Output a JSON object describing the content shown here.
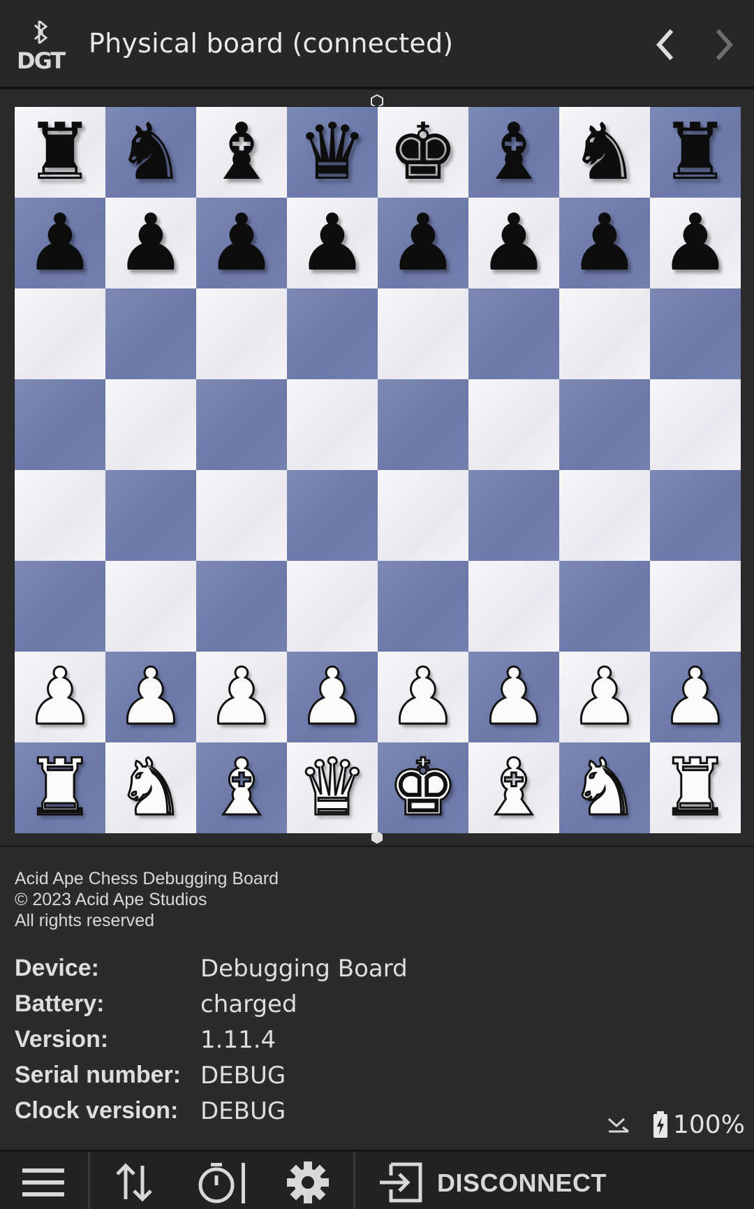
{
  "header": {
    "title": "Physical board (connected)",
    "logo_text": "DGT",
    "prev_icon": "chevron-left-icon",
    "next_icon": "chevron-right-icon"
  },
  "board": {
    "orientation": "white-bottom",
    "light_color": "#f0f0f4",
    "dark_color": "#7480ae",
    "ranks": [
      [
        "r",
        "n",
        "b",
        "q",
        "k",
        "b",
        "n",
        "r"
      ],
      [
        "p",
        "p",
        "p",
        "p",
        "p",
        "p",
        "p",
        "p"
      ],
      [
        "",
        "",
        "",
        "",
        "",
        "",
        "",
        ""
      ],
      [
        "",
        "",
        "",
        "",
        "",
        "",
        "",
        ""
      ],
      [
        "",
        "",
        "",
        "",
        "",
        "",
        "",
        ""
      ],
      [
        "",
        "",
        "",
        "",
        "",
        "",
        "",
        ""
      ],
      [
        "P",
        "P",
        "P",
        "P",
        "P",
        "P",
        "P",
        "P"
      ],
      [
        "R",
        "N",
        "B",
        "Q",
        "K",
        "B",
        "N",
        "R"
      ]
    ]
  },
  "info": {
    "copyright_lines": [
      "Acid Ape Chess Debugging Board",
      "© 2023 Acid Ape Studios",
      "All rights reserved"
    ],
    "properties": [
      {
        "key": "Device:",
        "value": "Debugging Board"
      },
      {
        "key": "Battery:",
        "value": "charged"
      },
      {
        "key": "Version:",
        "value": "1.11.4"
      },
      {
        "key": "Serial number:",
        "value": "DEBUG"
      },
      {
        "key": "Clock version:",
        "value": "DEBUG"
      }
    ],
    "battery_percent": "100%"
  },
  "toolbar": {
    "menu_icon": "menu-icon",
    "flip_icon": "flip-board-icon",
    "clock_icon": "clock-icon",
    "settings_icon": "gear-icon",
    "disconnect_label": "DISCONNECT"
  }
}
